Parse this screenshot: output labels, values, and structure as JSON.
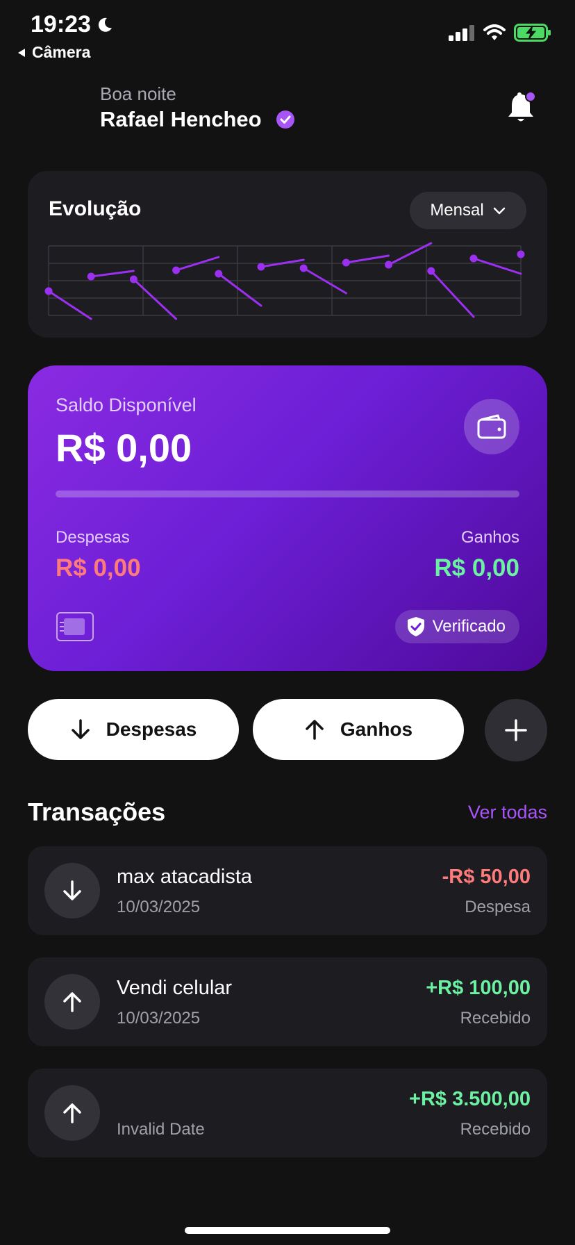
{
  "status_bar": {
    "time": "19:23",
    "back_label": "Câmera",
    "battery_color": "#4cd964"
  },
  "header": {
    "greeting": "Boa noite",
    "user_name": "Rafael Hencheo",
    "accent": "#a855f7"
  },
  "evolution": {
    "title": "Evolução",
    "period": "Mensal"
  },
  "chart_data": {
    "type": "line",
    "title": "Evolução",
    "grid": true,
    "segments": [
      [
        [
          0.0,
          0.65
        ],
        [
          0.09,
          1.05
        ]
      ],
      [
        [
          0.09,
          0.44
        ],
        [
          0.18,
          0.36
        ]
      ],
      [
        [
          0.18,
          0.48
        ],
        [
          0.27,
          1.05
        ]
      ],
      [
        [
          0.27,
          0.35
        ],
        [
          0.36,
          0.16
        ]
      ],
      [
        [
          0.36,
          0.4
        ],
        [
          0.45,
          0.86
        ]
      ],
      [
        [
          0.45,
          0.3
        ],
        [
          0.54,
          0.2
        ]
      ],
      [
        [
          0.54,
          0.32
        ],
        [
          0.63,
          0.68
        ]
      ],
      [
        [
          0.63,
          0.24
        ],
        [
          0.72,
          0.14
        ]
      ],
      [
        [
          0.72,
          0.27
        ],
        [
          0.81,
          -0.04
        ]
      ],
      [
        [
          0.81,
          0.36
        ],
        [
          0.9,
          1.02
        ]
      ],
      [
        [
          0.9,
          0.18
        ],
        [
          1.0,
          0.4
        ]
      ]
    ],
    "end_point": [
      1.0,
      0.12
    ],
    "line_color": "#9b30f0"
  },
  "balance": {
    "label": "Saldo Disponível",
    "value": "R$ 0,00",
    "progress_fraction": 0,
    "expenses_label": "Despesas",
    "expenses_value": "R$ 0,00",
    "income_label": "Ganhos",
    "income_value": "R$ 0,00",
    "verified_label": "Verificado",
    "icons": [
      "wallet-icon",
      "card-chip-icon",
      "shield-check-icon"
    ]
  },
  "actions": {
    "expenses": "Despesas",
    "income": "Ganhos"
  },
  "transactions": {
    "title": "Transações",
    "see_all": "Ver todas",
    "items": [
      {
        "name": "max atacadista",
        "date": "10/03/2025",
        "amount": "-R$ 50,00",
        "type": "Despesa",
        "direction": "down"
      },
      {
        "name": "Vendi celular",
        "date": "10/03/2025",
        "amount": "+R$ 100,00",
        "type": "Recebido",
        "direction": "up"
      },
      {
        "name": "",
        "date": "Invalid Date",
        "amount": "+R$ 3.500,00",
        "type": "Recebido",
        "direction": "up"
      }
    ]
  }
}
